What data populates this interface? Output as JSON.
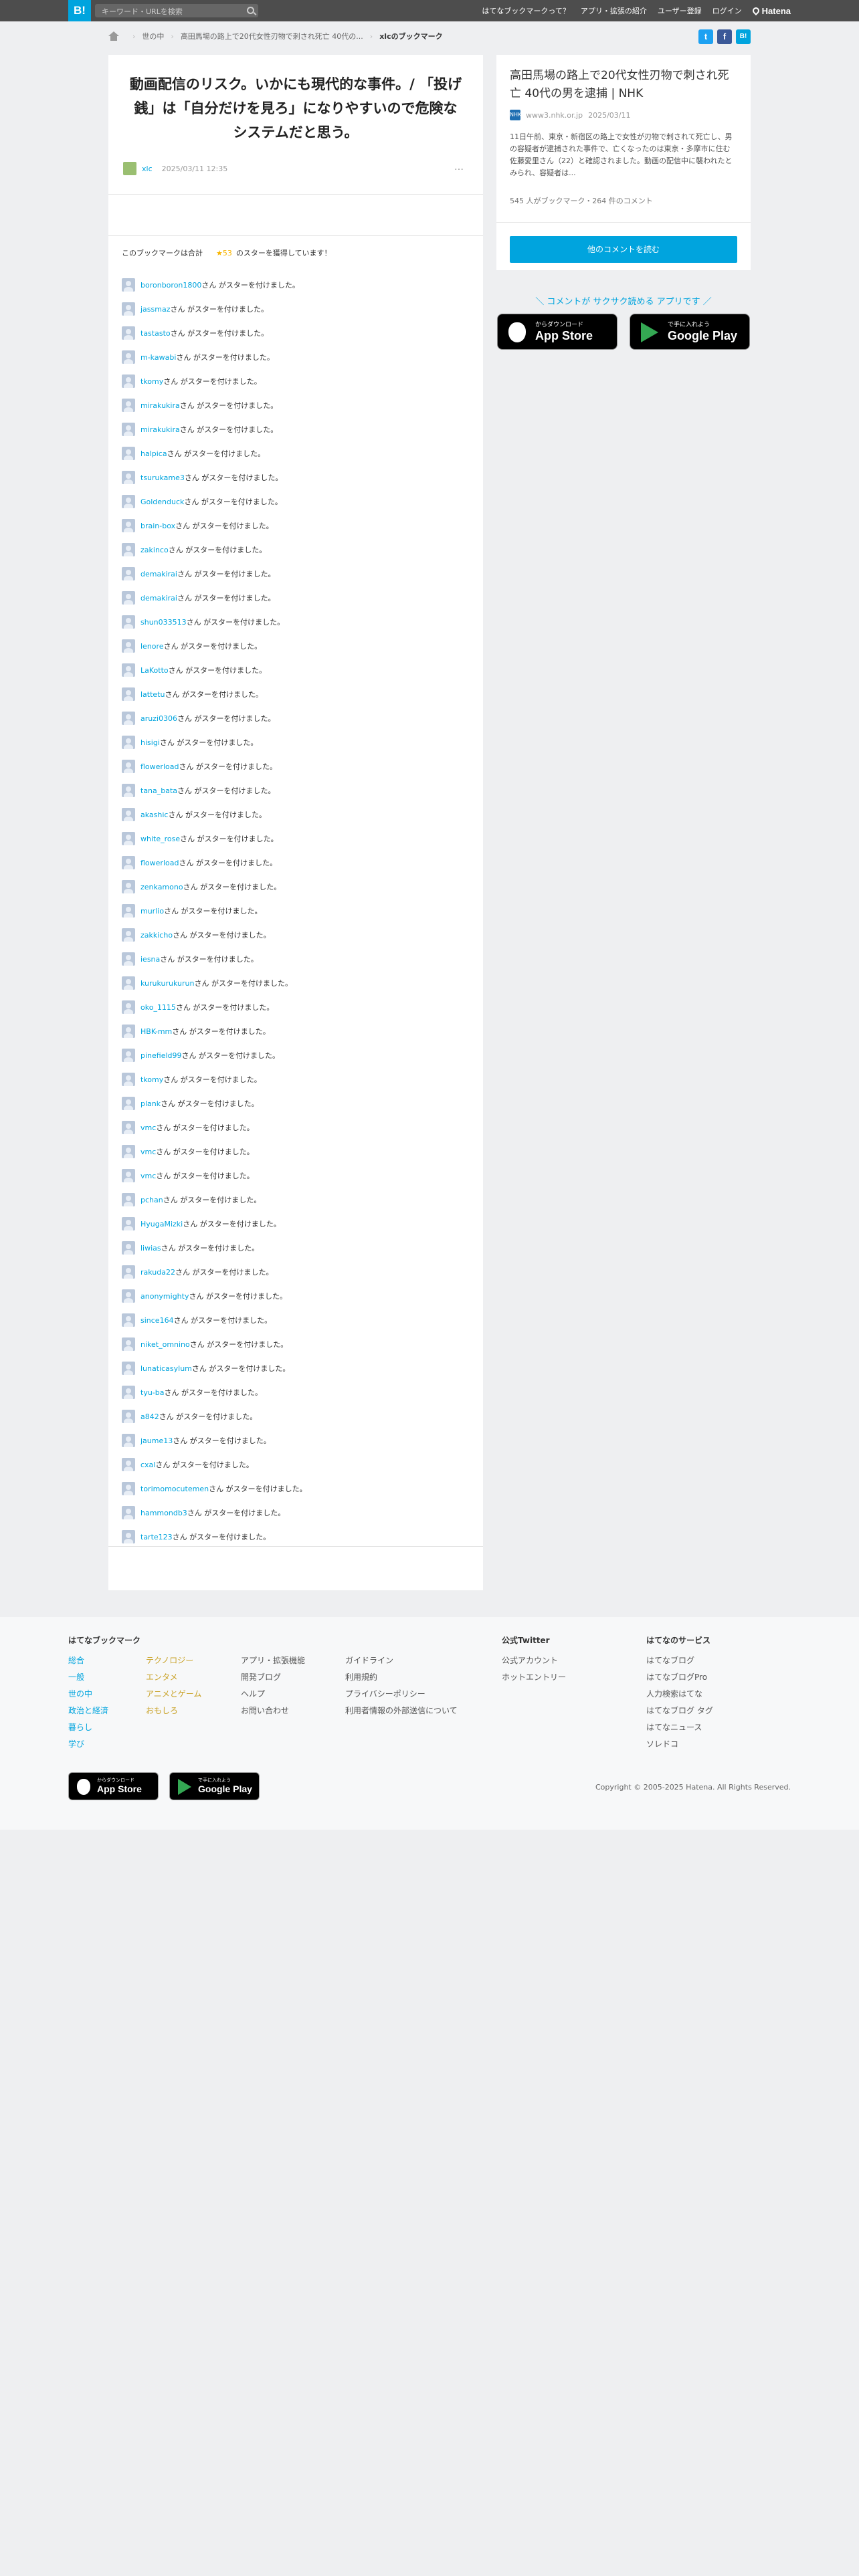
{
  "header": {
    "logo": "B!",
    "search_placeholder": "キーワード・URLを検索",
    "nav": [
      "はてなブックマークって？",
      "アプリ・拡張の紹介",
      "ユーザー登録",
      "ログイン"
    ],
    "brand": "Hatena"
  },
  "breadcrumb": {
    "items": [
      "世の中",
      "高田馬場の路上で20代女性刃物で刺され死亡 40代の..."
    ],
    "current": "xlcのブックマーク"
  },
  "share": {
    "twitter": "t",
    "facebook": "f",
    "hatena": "B!"
  },
  "bookmark": {
    "comment": "動画配信のリスク。いかにも現代的な事件。/ 「投げ銭」は「自分だけを見ろ」になりやすいので危険なシステムだと思う。",
    "user": "xlc",
    "date": "2025/03/11 12:35",
    "menu": "…"
  },
  "stars": {
    "prefix": "このブックマークは合計",
    "count": "53",
    "suffix": "のスターを獲得しています！",
    "suffix_text": "さん がスターを付けました。",
    "users": [
      "boronboron1800",
      "jassmaz",
      "tastasto",
      "m-kawabi",
      "tkomy",
      "mirakukira",
      "mirakukira",
      "halpica",
      "tsurukame3",
      "Goldenduck",
      "brain-box",
      "zakinco",
      "demakirai",
      "demakirai",
      "shun033513",
      "lenore",
      "LaKotto",
      "lattetu",
      "aruzi0306",
      "hisigi",
      "flowerload",
      "tana_bata",
      "akashic",
      "white_rose",
      "flowerload",
      "zenkamono",
      "murlio",
      "zakkicho",
      "iesna",
      "kurukurukurun",
      "oko_1115",
      "HBK-mm",
      "pinefield99",
      "tkomy",
      "plank",
      "vmc",
      "vmc",
      "vmc",
      "pchan",
      "HyugaMizki",
      "liwias",
      "rakuda22",
      "anonymighty",
      "since164",
      "niket_omnino",
      "lunaticasylum",
      "tyu-ba",
      "a842",
      "jaume13",
      "cxal",
      "torimomocutemen",
      "hammondb3",
      "tarte123"
    ]
  },
  "entry": {
    "title": "高田馬場の路上で20代女性刃物で刺され死亡 40代の男を逮捕 | NHK",
    "domain": "www3.nhk.or.jp",
    "date": "2025/03/11",
    "favicon": "NHK",
    "description": "11日午前、東京・新宿区の路上で女性が刃物で刺されて死亡し、男の容疑者が逮捕された事件で、亡くなったのは東京・多摩市に住む佐藤愛里さん（22）と確認されました。動画の配信中に襲われたとみられ、容疑者は...",
    "counts": "545 人がブックマーク・264 件のコメント",
    "button": "他のコメントを読む"
  },
  "promo": {
    "text": "＼ コメントが サクサク読める アプリです ／",
    "appstore_small": "からダウンロード",
    "appstore": "App Store",
    "googleplay_small": "で手に入れよう",
    "googleplay": "Google Play"
  },
  "footer": {
    "col1_title": "はてなブックマーク",
    "col1a": [
      "総合",
      "一般",
      "世の中",
      "政治と経済",
      "暮らし",
      "学び"
    ],
    "col1b": [
      "テクノロジー",
      "エンタメ",
      "アニメとゲーム",
      "おもしろ"
    ],
    "col2": [
      "アプリ・拡張機能",
      "開発ブログ",
      "ヘルプ",
      "お問い合わせ"
    ],
    "col3": [
      "ガイドライン",
      "利用規約",
      "プライバシーポリシー",
      "利用者情報の外部送信について"
    ],
    "col4_title": "公式Twitter",
    "col4": [
      "公式アカウント",
      "ホットエントリー"
    ],
    "col5_title": "はてなのサービス",
    "col5": [
      "はてなブログ",
      "はてなブログPro",
      "人力検索はてな",
      "はてなブログ タグ",
      "はてなニュース",
      "ソレドコ"
    ],
    "copyright": "Copyright © 2005-2025 Hatena. All Rights Reserved."
  },
  "colors": {
    "accent": "#00a4de",
    "star": "#f8b500"
  }
}
